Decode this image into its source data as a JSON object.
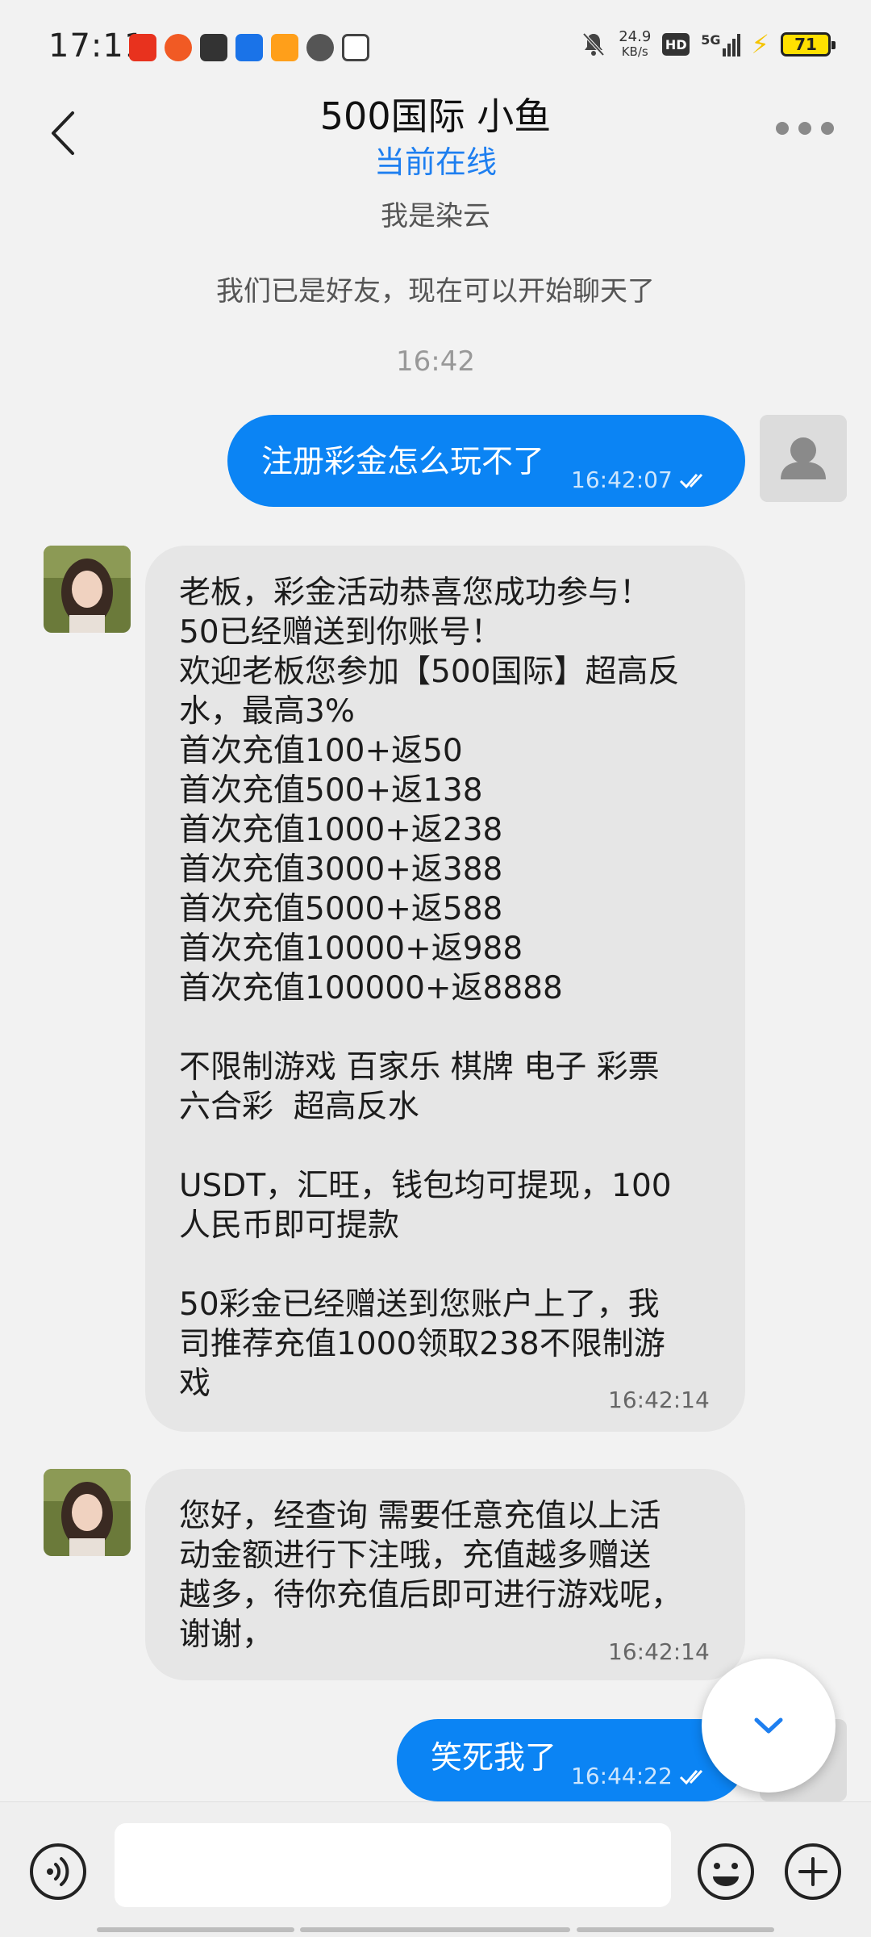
{
  "status_bar": {
    "time": "17:11",
    "net_speed_value": "24.9",
    "net_speed_unit": "KB/s",
    "hd": "HD",
    "network": "5G",
    "battery": "71"
  },
  "header": {
    "title": "500国际 小鱼",
    "status": "当前在线"
  },
  "notes": {
    "signature": "我是染云",
    "friend_notice": "我们已是好友，现在可以开始聊天了",
    "time_divider": "16:42"
  },
  "messages": [
    {
      "side": "out",
      "text": "注册彩金怎么玩不了",
      "time": "16:42:07"
    },
    {
      "side": "in",
      "text": "老板，彩金活动恭喜您成功参与！\n50已经赠送到你账号！\n欢迎老板您参加【500国际】超高反\n水，最高3%\n首次充值100+返50\n首次充值500+返138\n首次充值1000+返238\n首次充值3000+返388\n首次充值5000+返588\n首次充值10000+返988\n首次充值100000+返8888\n\n不限制游戏 百家乐 棋牌 电子 彩票\n六合彩  超高反水\n\nUSDT，汇旺，钱包均可提现，100\n人民币即可提款\n\n50彩金已经赠送到您账户上了，我\n司推荐充值1000领取238不限制游\n戏",
      "time": "16:42:14"
    },
    {
      "side": "in",
      "text": "您好，经查询 需要任意充值以上活\n动金额进行下注哦，充值越多赠送\n越多，待你充值后即可进行游戏呢，\n谢谢，",
      "time": "16:42:14"
    },
    {
      "side": "out",
      "text": "笑死我了",
      "time": "16:44:22"
    }
  ],
  "icons": {
    "back": "back-arrow-icon",
    "more": "more-dots-icon",
    "scroll_down": "chevron-down-icon",
    "voice": "voice-icon",
    "emoji": "emoji-icon",
    "plus": "plus-icon"
  },
  "colors": {
    "accent": "#1e7ff0",
    "outgoing_bubble": "#0b84f4",
    "incoming_bubble": "#e6e6e6",
    "background": "#f2f2f2"
  }
}
